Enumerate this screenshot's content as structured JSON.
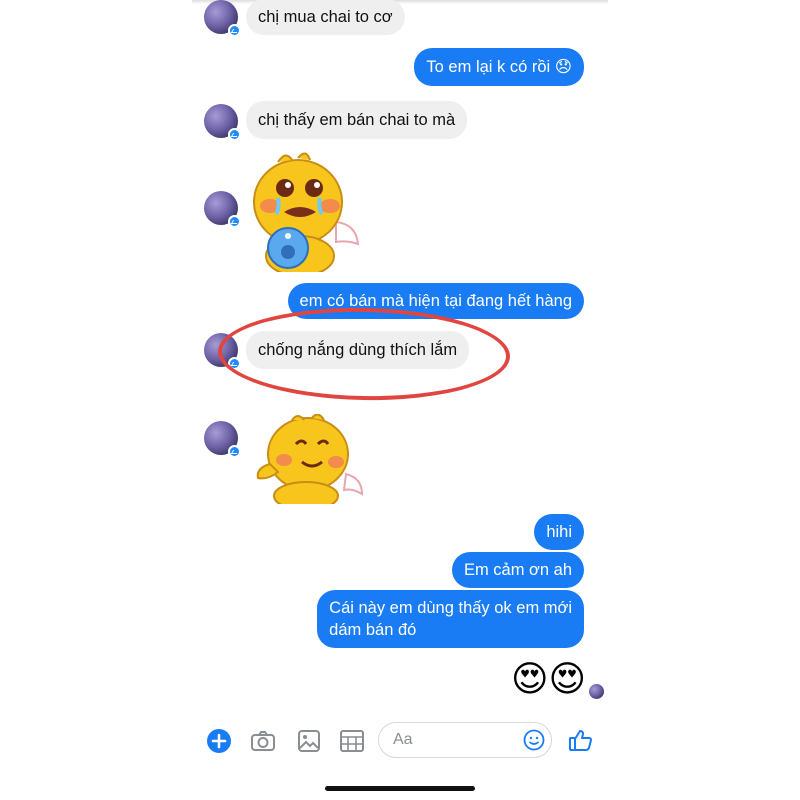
{
  "messages": [
    {
      "side": "in",
      "text": "chị  mua chai to cơ"
    },
    {
      "side": "out",
      "text": "To em lại k có rồi 😞"
    },
    {
      "side": "in",
      "text": "chị  thấy  em bán  chai to mà"
    },
    {
      "side": "out",
      "text": "em có bán mà hiện tại đang hết hàng"
    },
    {
      "side": "in",
      "text": "chống nắng  dùng  thích  lắm"
    },
    {
      "side": "out",
      "text": "hihi"
    },
    {
      "side": "out",
      "text": "Em cảm ơn ah"
    },
    {
      "side": "out",
      "text_line1": "Cái này em dùng thấy ok em mới",
      "text_line2": "dám bán đó"
    },
    {
      "side": "out",
      "text": "😍😍"
    }
  ],
  "composer": {
    "placeholder": "Aa"
  },
  "colors": {
    "outgoing": "#1a7cf5",
    "incoming": "#efefef",
    "annotation": "#e0463f",
    "sticker": "#f6c21c"
  },
  "icons": [
    "plus-icon",
    "camera-icon",
    "gallery-icon",
    "gif-icon",
    "emoji-icon",
    "thumbs-up-icon",
    "messenger-badge-icon"
  ]
}
